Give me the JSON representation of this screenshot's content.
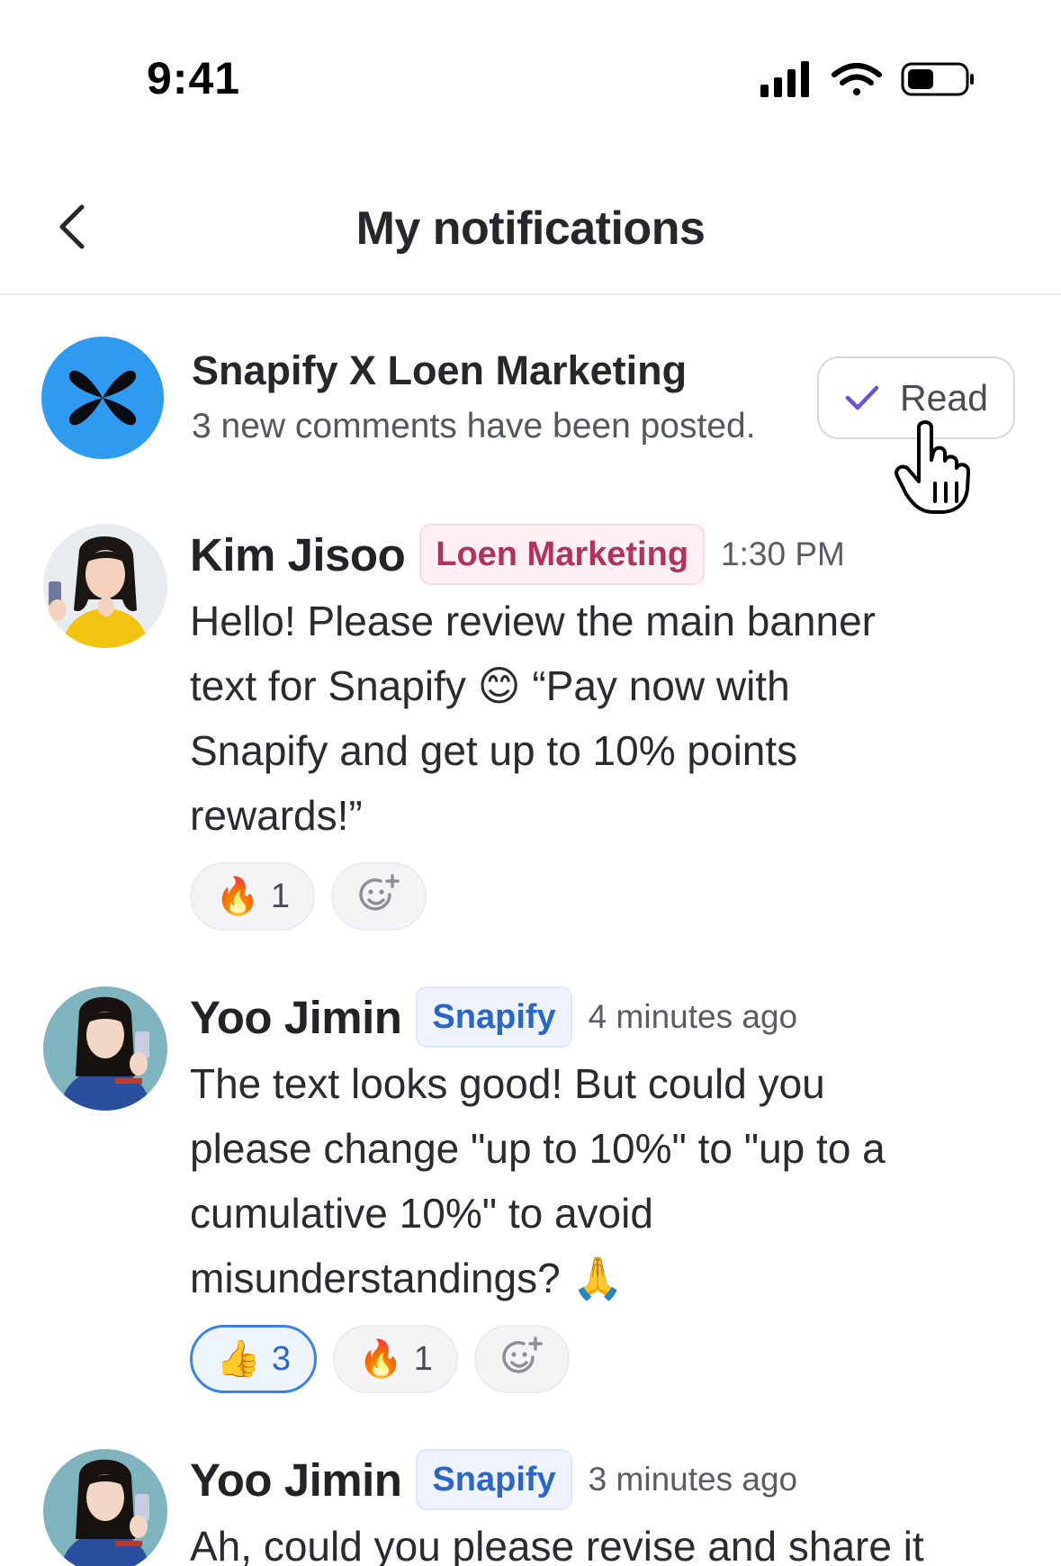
{
  "status_bar": {
    "time": "9:41"
  },
  "header": {
    "title": "My notifications"
  },
  "summary": {
    "title": "Snapify X Loen Marketing",
    "subtitle": "3 new comments have been posted.",
    "read_label": "Read",
    "brand_color": "#2f9bf0",
    "check_color": "#6b4fe0"
  },
  "comments": [
    {
      "author": "Kim Jisoo",
      "tag": "Loen Marketing",
      "time": "1:30 PM",
      "body_lines": [
        "Hello! Please review the main banner",
        "text for Snapify 😊 “Pay now with",
        "Snapify and get up to 10% points",
        "rewards!”"
      ],
      "reactions": [
        {
          "emoji": "🔥",
          "count": "1",
          "active": false
        }
      ]
    },
    {
      "author": "Yoo Jimin",
      "tag": "Snapify",
      "time": "4 minutes ago",
      "body_lines": [
        "The text looks good! But could you",
        "please change \"up to 10%\" to \"up to a",
        "cumulative 10%\" to avoid",
        "misunderstandings? 🙏"
      ],
      "reactions": [
        {
          "emoji": "👍",
          "count": "3",
          "active": true
        },
        {
          "emoji": "🔥",
          "count": "1",
          "active": false
        }
      ]
    },
    {
      "author": "Yoo Jimin",
      "tag": "Snapify",
      "time": "3 minutes ago",
      "body_lines": [
        "Ah, could you please revise and share it"
      ]
    }
  ]
}
